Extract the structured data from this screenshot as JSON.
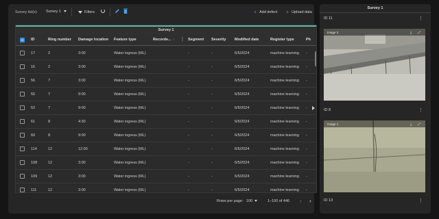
{
  "toolbar": {
    "survey_label": "Survey list(s)",
    "survey_select": "Survey 1",
    "filters_label": "Filters",
    "add_defect_label": "Add defect",
    "upload_data_label": "Upload data"
  },
  "table": {
    "title": "Survey 1",
    "columns": {
      "id": "ID",
      "ring": "Ring number",
      "damage": "Damage location",
      "feature": "Feature type",
      "recorded": "Recorde...",
      "segment": "Segment",
      "severity": "Severity",
      "modified": "Modified date",
      "register": "Register type",
      "ph": "Ph"
    },
    "rows": [
      {
        "id": "17",
        "ring": "2",
        "damage": "3:00",
        "feature": "Water ingress (ML)",
        "recorded": "-",
        "segment": "-",
        "severity": "-",
        "modified": "6/5/2024",
        "register": "machine learning",
        "ph": "-"
      },
      {
        "id": "16",
        "ring": "2",
        "damage": "3:00",
        "feature": "Water ingress (ML)",
        "recorded": "-",
        "segment": "-",
        "severity": "-",
        "modified": "6/5/2024",
        "register": "machine learning",
        "ph": "-"
      },
      {
        "id": "56",
        "ring": "7",
        "damage": "3:00",
        "feature": "Water ingress (ML)",
        "recorded": "-",
        "segment": "-",
        "severity": "-",
        "modified": "6/5/2024",
        "register": "machine learning",
        "ph": "-"
      },
      {
        "id": "55",
        "ring": "7",
        "damage": "9:00",
        "feature": "Water ingress (ML)",
        "recorded": "-",
        "segment": "-",
        "severity": "-",
        "modified": "6/5/2024",
        "register": "machine learning",
        "ph": "-"
      },
      {
        "id": "52",
        "ring": "7",
        "damage": "9:00",
        "feature": "Water ingress (ML)",
        "recorded": "-",
        "segment": "-",
        "severity": "-",
        "modified": "6/5/2024",
        "register": "machine learning",
        "ph": "-"
      },
      {
        "id": "61",
        "ring": "8",
        "damage": "4:30",
        "feature": "Water ingress (ML)",
        "recorded": "-",
        "segment": "-",
        "severity": "-",
        "modified": "6/5/2024",
        "register": "machine learning",
        "ph": "-"
      },
      {
        "id": "60",
        "ring": "8",
        "damage": "9:00",
        "feature": "Water ingress (ML)",
        "recorded": "-",
        "segment": "-",
        "severity": "-",
        "modified": "6/5/2024",
        "register": "machine learning",
        "ph": "-"
      },
      {
        "id": "114",
        "ring": "12",
        "damage": "12:00",
        "feature": "Water ingress (ML)",
        "recorded": "-",
        "segment": "-",
        "severity": "-",
        "modified": "6/5/2024",
        "register": "machine learning",
        "ph": "-"
      },
      {
        "id": "108",
        "ring": "12",
        "damage": "3:00",
        "feature": "Water ingress (ML)",
        "recorded": "-",
        "segment": "-",
        "severity": "-",
        "modified": "6/5/2024",
        "register": "machine learning",
        "ph": "-"
      },
      {
        "id": "109",
        "ring": "12",
        "damage": "3:00",
        "feature": "Water ingress (ML)",
        "recorded": "-",
        "segment": "-",
        "severity": "-",
        "modified": "6/5/2024",
        "register": "machine learning",
        "ph": "-"
      },
      {
        "id": "111",
        "ring": "12",
        "damage": "3:00",
        "feature": "Water ingress (ML)",
        "recorded": "-",
        "segment": "-",
        "severity": "-",
        "modified": "6/5/2024",
        "register": "machine learning",
        "ph": "-"
      }
    ]
  },
  "pagination": {
    "rows_per_page_label": "Rows per page:",
    "rows_per_page": "100",
    "range": "1–100 of 446"
  },
  "right_panel": {
    "title": "Survey 1",
    "cards": [
      {
        "id_label": "ID 11",
        "image_label": "Image 2"
      },
      {
        "id_label": "ID 8",
        "image_label": "Image 1"
      },
      {
        "id_label": "ID 13"
      }
    ]
  },
  "colors": {
    "accent": "#3d8ee6",
    "survey_header_stripe": "#5fb5b0",
    "panel_bg": "#262626",
    "page_bg": "#151515"
  }
}
